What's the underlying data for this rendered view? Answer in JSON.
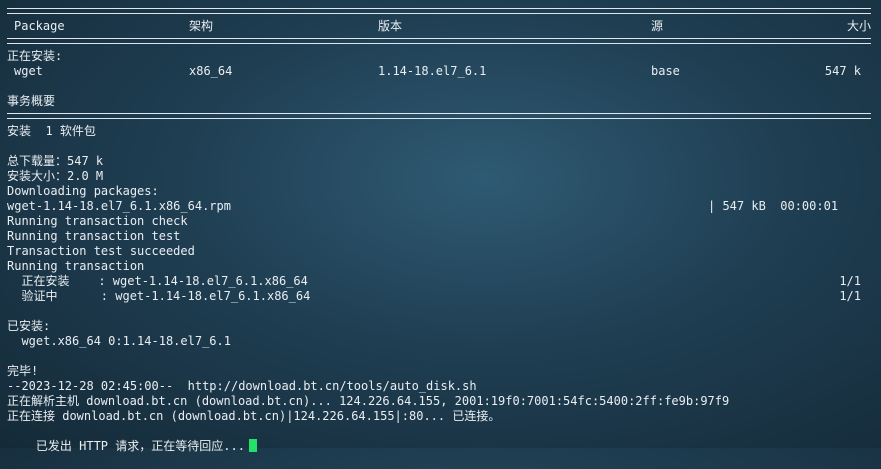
{
  "header": {
    "col_package": "Package",
    "col_arch": "架构",
    "col_version": "版本",
    "col_repo": "源",
    "col_size": "大小"
  },
  "installing": {
    "title": "正在安装:",
    "name": "wget",
    "arch": "x86_64",
    "version": "1.14-18.el7_6.1",
    "repo": "base",
    "size": "547 k"
  },
  "summary": {
    "title": "事务概要",
    "install_line": "安装  1 软件包",
    "total_download": "总下载量：547 k",
    "install_size": "安装大小：2.0 M",
    "downloading": "Downloading packages:",
    "rpm_file": "wget-1.14-18.el7_6.1.x86_64.rpm",
    "rpm_progress": "| 547 kB  00:00:01",
    "check": "Running transaction check",
    "test": "Running transaction test",
    "test_ok": "Transaction test succeeded",
    "running": "Running transaction",
    "step_install_label": "  正在安装    : wget-1.14-18.el7_6.1.x86_64",
    "step_install_count": "1/1",
    "step_verify_label": "  验证中      : wget-1.14-18.el7_6.1.x86_64",
    "step_verify_count": "1/1"
  },
  "installed": {
    "title": "已安装:",
    "pkg": "  wget.x86_64 0:1.14-18.el7_6.1"
  },
  "tail": {
    "done": "完毕!",
    "wget_cmd": "--2023-12-28 02:45:00--  http://download.bt.cn/tools/auto_disk.sh",
    "resolving": "正在解析主机 download.bt.cn (download.bt.cn)... 124.226.64.155, 2001:19f0:7001:54fc:5400:2ff:fe9b:97f9",
    "connecting": "正在连接 download.bt.cn (download.bt.cn)|124.226.64.155|:80... 已连接。",
    "http_sent": "已发出 HTTP 请求，正在等待回应..."
  },
  "colors": {
    "cursor": "#22e06a",
    "text": "#e9eef2"
  }
}
